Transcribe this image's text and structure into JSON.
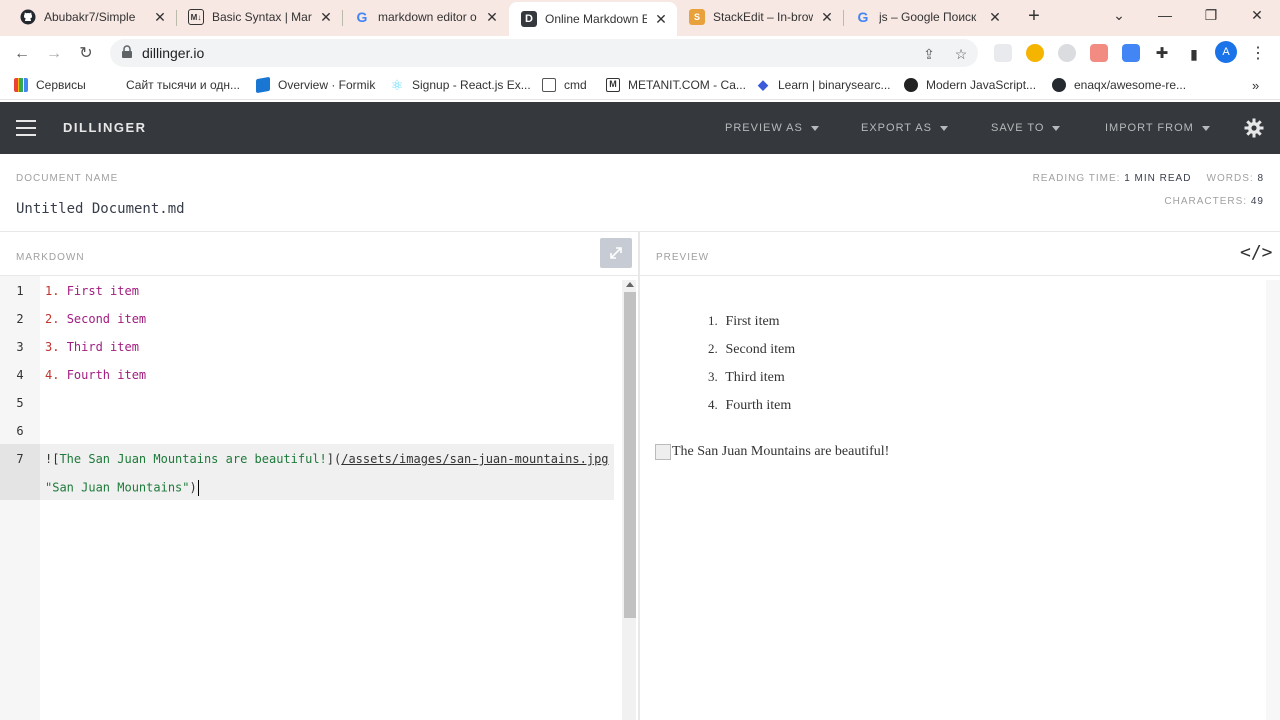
{
  "browser": {
    "tabs": [
      {
        "title": "Abubakr7/Simple",
        "icon": "github-icon"
      },
      {
        "title": "Basic Syntax | Mark",
        "icon": "markdown-icon"
      },
      {
        "title": "markdown editor o",
        "icon": "google-icon"
      },
      {
        "title": "Online Markdown E",
        "icon": "dillinger-icon",
        "active": true
      },
      {
        "title": "StackEdit – In-brow",
        "icon": "stackedit-icon"
      },
      {
        "title": "js – Google Поиск",
        "icon": "google-icon"
      }
    ],
    "url": "dillinger.io",
    "profile_initial": "A",
    "bookmarks": [
      {
        "label": "Сервисы",
        "icon": "apps-icon"
      },
      {
        "label": "Сайт тысячи и одн...",
        "icon": "page-icon"
      },
      {
        "label": "Overview · Formik",
        "icon": "formik-icon"
      },
      {
        "label": "Signup - React.js Ex...",
        "icon": "react-icon"
      },
      {
        "label": "cmd",
        "icon": "cmd-icon"
      },
      {
        "label": "METANIT.COM - Са...",
        "icon": "metanit-icon"
      },
      {
        "label": "Learn | binarysearc...",
        "icon": "binarysearch-icon"
      },
      {
        "label": "Modern JavaScript...",
        "icon": "js-icon"
      },
      {
        "label": "enaqx/awesome-re...",
        "icon": "github-icon"
      }
    ]
  },
  "app": {
    "brand": "DILLINGER",
    "menu": {
      "preview_as": "PREVIEW AS",
      "export_as": "EXPORT AS",
      "save_to": "SAVE TO",
      "import_from": "IMPORT FROM"
    },
    "document": {
      "label": "DOCUMENT NAME",
      "name": "Untitled Document.md"
    },
    "stats": {
      "reading_time_label": "READING TIME:",
      "reading_time_value": "1 MIN READ",
      "words_label": "WORDS:",
      "words_value": "8",
      "characters_label": "CHARACTERS:",
      "characters_value": "49"
    },
    "markdown_label": "MARKDOWN",
    "preview_label": "PREVIEW",
    "editor_lines": [
      "1",
      "2",
      "3",
      "4",
      "5",
      "6",
      "7"
    ],
    "editor": {
      "line1": {
        "num": "1.",
        "text": "First item"
      },
      "line2": {
        "num": "2.",
        "text": "Second item"
      },
      "line3": {
        "num": "3.",
        "text": "Third item"
      },
      "line4": {
        "num": "4.",
        "text": "Fourth item"
      },
      "line7a": {
        "open": "![",
        "alt": "The San Juan Mountains are beautiful!",
        "mid": "](",
        "url": "/assets/images/san-juan-mountains.jpg"
      },
      "line7b": {
        "title": "\"San Juan Mountains\"",
        "close": ")"
      }
    },
    "preview": {
      "items": [
        {
          "n": "1.",
          "text": "First item"
        },
        {
          "n": "2.",
          "text": "Second item"
        },
        {
          "n": "3.",
          "text": "Third item"
        },
        {
          "n": "4.",
          "text": "Fourth item"
        }
      ],
      "image_alt": "The San Juan Mountains are beautiful!"
    }
  }
}
